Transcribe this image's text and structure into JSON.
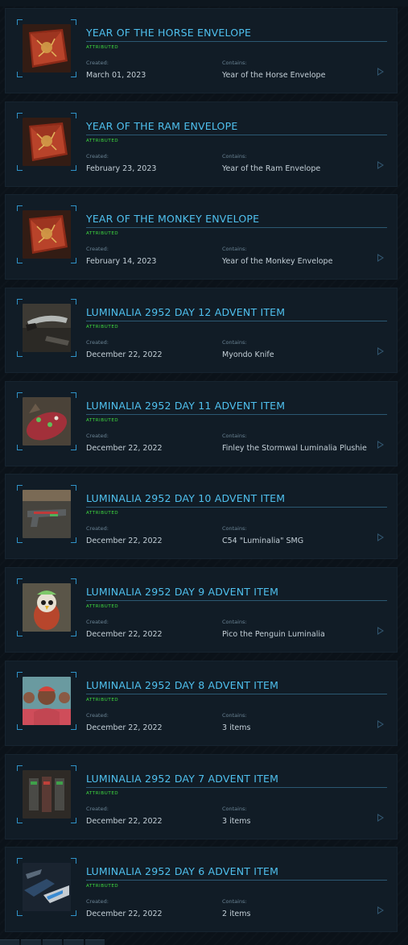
{
  "labels": {
    "badge": "ATTRIBUTED",
    "created": "Created:",
    "contains": "Contains:"
  },
  "items": [
    {
      "title": "YEAR OF THE HORSE ENVELOPE",
      "created": "March 01, 2023",
      "contains": "Year of the Horse Envelope",
      "icon": "red-envelope"
    },
    {
      "title": "YEAR OF THE RAM ENVELOPE",
      "created": "February 23, 2023",
      "contains": "Year of the Ram Envelope",
      "icon": "red-envelope"
    },
    {
      "title": "YEAR OF THE MONKEY ENVELOPE",
      "created": "February 14, 2023",
      "contains": "Year of the Monkey Envelope",
      "icon": "red-envelope"
    },
    {
      "title": "LUMINALIA 2952 DAY 12 ADVENT ITEM",
      "created": "December 22, 2022",
      "contains": "Myondo Knife",
      "icon": "knife"
    },
    {
      "title": "LUMINALIA 2952 DAY 11 ADVENT ITEM",
      "created": "December 22, 2022",
      "contains": "Finley the Stormwal Luminalia Plushie",
      "icon": "plushie"
    },
    {
      "title": "LUMINALIA 2952 DAY 10 ADVENT ITEM",
      "created": "December 22, 2022",
      "contains": "C54 \"Luminalia\" SMG",
      "icon": "smg"
    },
    {
      "title": "LUMINALIA 2952 DAY 9 ADVENT ITEM",
      "created": "December 22, 2022",
      "contains": "Pico the Penguin Luminalia",
      "icon": "penguin"
    },
    {
      "title": "LUMINALIA 2952 DAY 8 ADVENT ITEM",
      "created": "December 22, 2022",
      "contains": "3 items",
      "icon": "character"
    },
    {
      "title": "LUMINALIA 2952 DAY 7 ADVENT ITEM",
      "created": "December 22, 2022",
      "contains": "3 items",
      "icon": "armor"
    },
    {
      "title": "LUMINALIA 2952 DAY 6 ADVENT ITEM",
      "created": "December 22, 2022",
      "contains": "2 items",
      "icon": "ship-paints"
    }
  ]
}
